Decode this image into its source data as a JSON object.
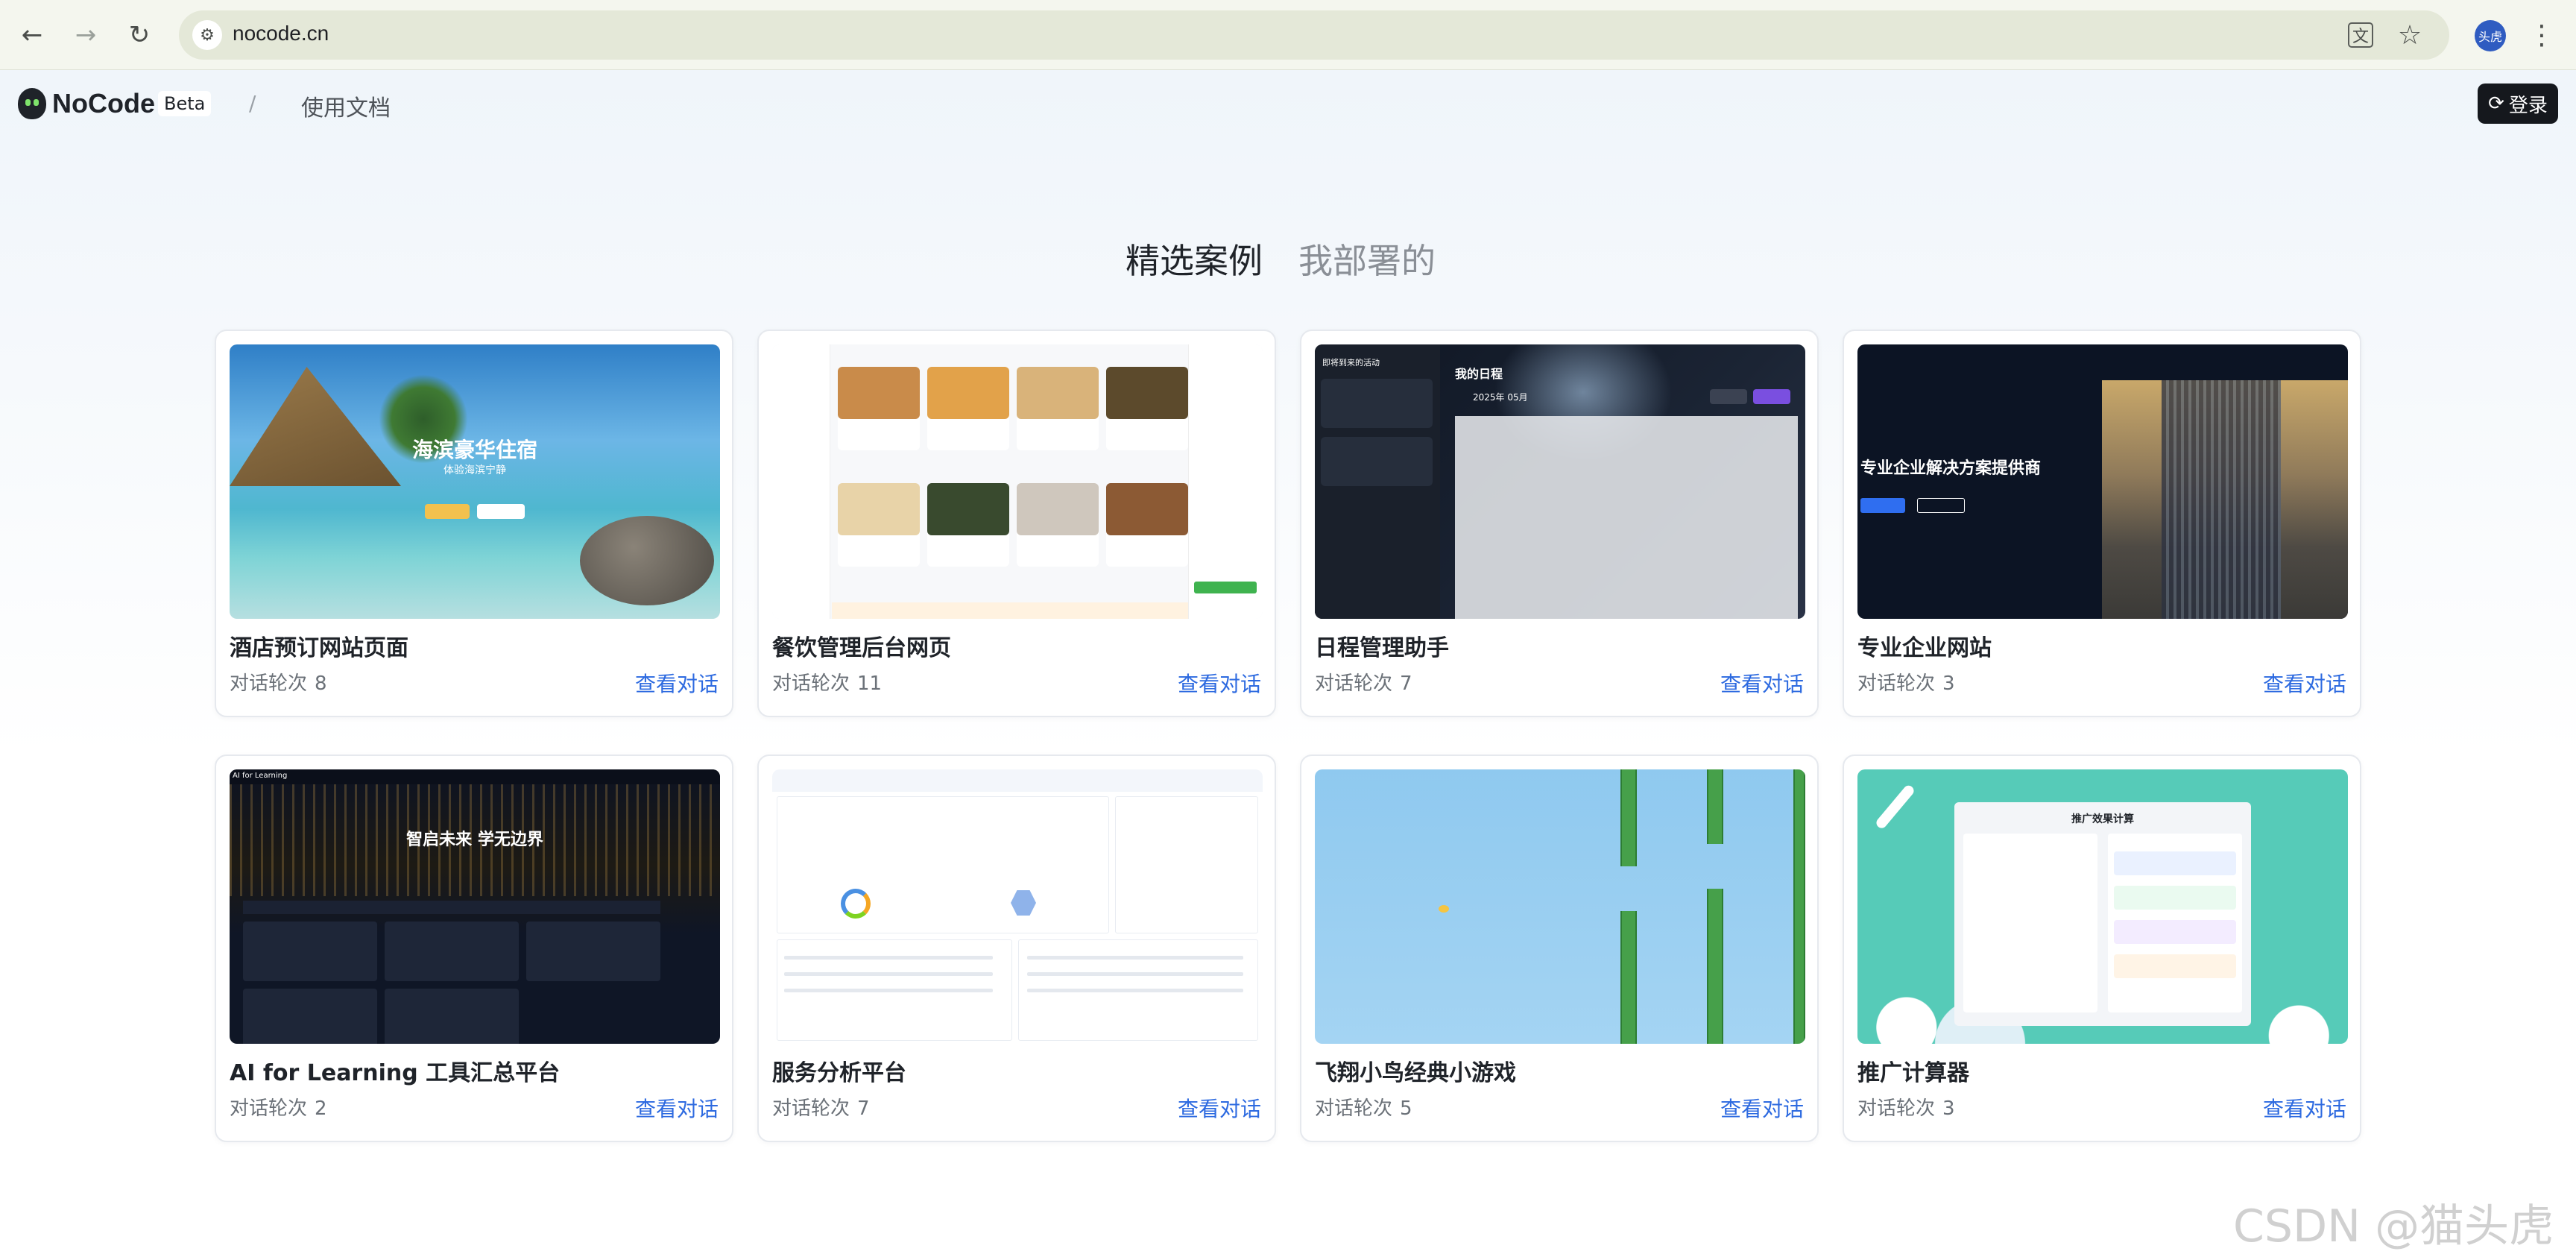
{
  "browser": {
    "url": "nocode.cn",
    "profile_label": "头虎"
  },
  "header": {
    "brand": "NoCode",
    "badge": "Beta",
    "separator": "/",
    "docs_link": "使用文档",
    "login_label": "登录"
  },
  "tabs": [
    {
      "label": "精选案例",
      "active": true
    },
    {
      "label": "我部署的",
      "active": false
    }
  ],
  "cards": [
    {
      "title": "酒店预订网站页面",
      "meta_label": "对话轮次",
      "count": "8",
      "link": "查看对话"
    },
    {
      "title": "餐饮管理后台网页",
      "meta_label": "对话轮次",
      "count": "11",
      "link": "查看对话"
    },
    {
      "title": "日程管理助手",
      "meta_label": "对话轮次",
      "count": "7",
      "link": "查看对话"
    },
    {
      "title": "专业企业网站",
      "meta_label": "对话轮次",
      "count": "3",
      "link": "查看对话"
    },
    {
      "title": "AI for Learning 工具汇总平台",
      "meta_label": "对话轮次",
      "count": "2",
      "link": "查看对话"
    },
    {
      "title": "服务分析平台",
      "meta_label": "对话轮次",
      "count": "7",
      "link": "查看对话"
    },
    {
      "title": "飞翔小鸟经典小游戏",
      "meta_label": "对话轮次",
      "count": "5",
      "link": "查看对话"
    },
    {
      "title": "推广计算器",
      "meta_label": "对话轮次",
      "count": "3",
      "link": "查看对话"
    }
  ],
  "thumbs": {
    "hotel": {
      "headline": "海滨豪华住宿",
      "sub": "体验海滨宁静"
    },
    "schedule": {
      "heading": "我的日程",
      "month": "2025年 05月",
      "left_title": "即将到来的活动"
    },
    "enterprise": {
      "headline": "专业企业解决方案提供商"
    },
    "ai": {
      "headline": "智启未来 学无边界",
      "topbar": "AI for Learning"
    },
    "promo": {
      "heading": "推广效果计算"
    }
  },
  "watermark": "CSDN @猫头虎"
}
